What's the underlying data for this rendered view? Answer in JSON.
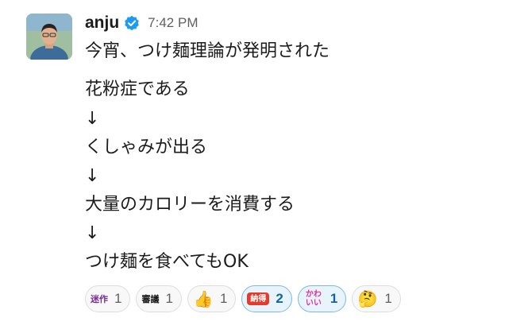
{
  "message": {
    "username": "anju",
    "timestamp": "7:42 PM",
    "lines": [
      "今宵、つけ麺理論が発明された",
      "花粉症である",
      "↓",
      "くしゃみが出る",
      "↓",
      "大量のカロリーを消費する",
      "↓",
      "つけ麺を食べてもOK"
    ]
  },
  "reactions": [
    {
      "emoji_text": "迷作",
      "icon": "meisaku-emoji",
      "count": "1",
      "active": false,
      "color": "#7b2c96"
    },
    {
      "emoji_text": "審議",
      "icon": "shingi-emoji",
      "count": "1",
      "active": false,
      "color": "#111111"
    },
    {
      "emoji_text": "👍",
      "icon": "thumbs-up-emoji",
      "count": "1",
      "active": false,
      "color": "#f5b93b"
    },
    {
      "emoji_text": "納得",
      "icon": "nattoku-emoji",
      "count": "2",
      "active": true,
      "color": "#e33b2e"
    },
    {
      "emoji_text": "かわいい",
      "icon": "kawaii-emoji",
      "count": "1",
      "active": true,
      "color": "#e0319b"
    },
    {
      "emoji_text": "🤔",
      "icon": "thinking-face-emoji",
      "count": "1",
      "active": false,
      "color": "#f5b93b"
    }
  ],
  "colors": {
    "verified": "#1d9bf0",
    "active_border": "#7fb7dd",
    "active_count": "#1264a3"
  }
}
